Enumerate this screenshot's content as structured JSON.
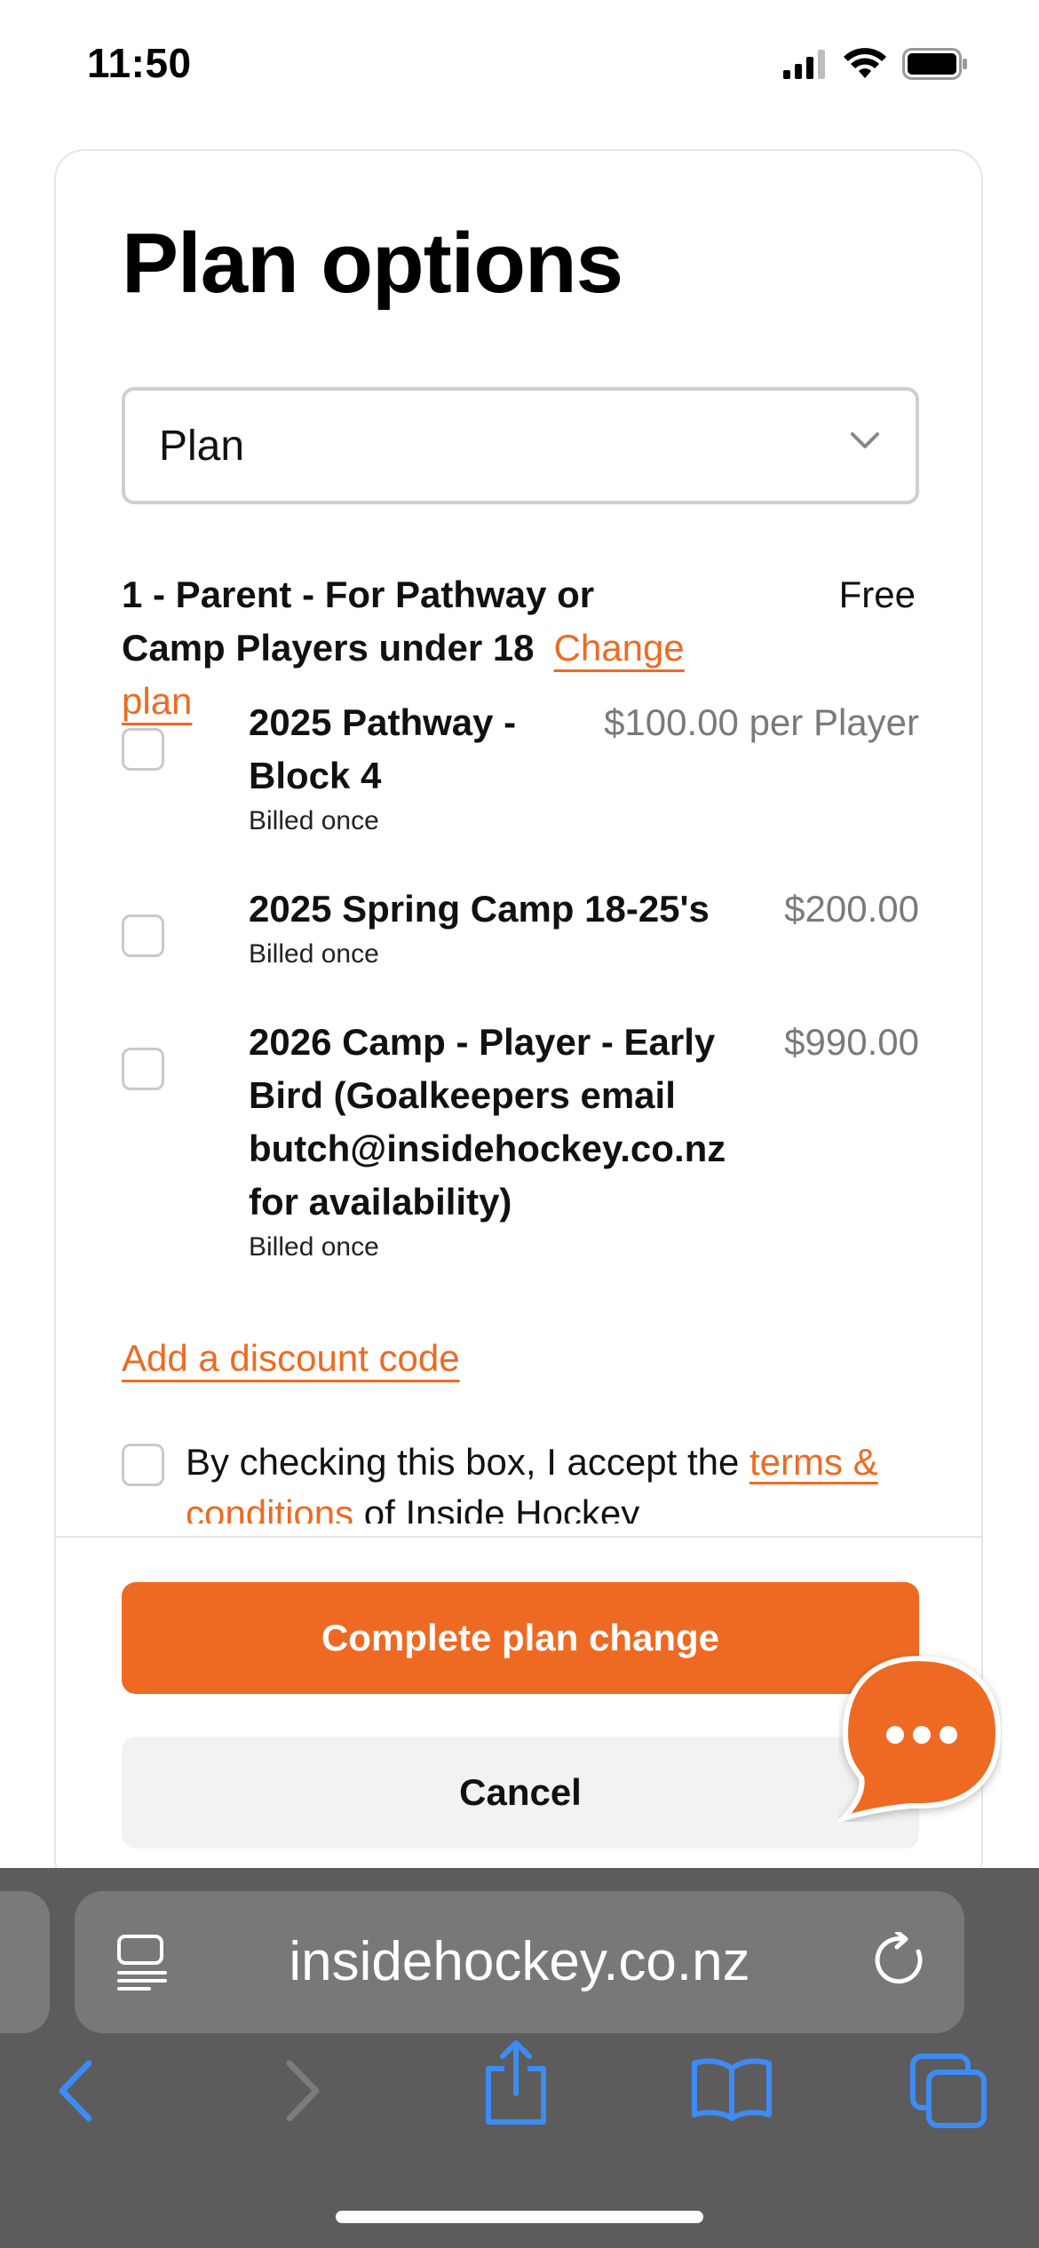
{
  "status_bar": {
    "time": "11:50"
  },
  "page": {
    "title": "Plan options",
    "plan_select": {
      "value": "Plan"
    },
    "current_plan": {
      "name": "1 - Parent - For Pathway or Camp Players under 18",
      "change_link": "Change plan",
      "price": "Free"
    },
    "options": [
      {
        "name": "2025 Pathway - Block 4",
        "price": "$100.00 per Player",
        "billing": "Billed once",
        "checked": false
      },
      {
        "name": "2025 Spring Camp 18-25's",
        "price": "$200.00",
        "billing": "Billed once",
        "checked": false
      },
      {
        "name": "2026 Camp - Player - Early Bird (Goalkeepers email butch@insidehockey.co.nz for availability)",
        "price": "$990.00",
        "billing": "Billed once",
        "checked": false
      }
    ],
    "discount_link": "Add a discount code",
    "terms": {
      "prefix": "By checking this box, I accept the ",
      "link": "terms & conditions",
      "suffix": " of Inside Hockey"
    },
    "complete_button": "Complete plan change",
    "cancel_button": "Cancel"
  },
  "browser": {
    "url": "insidehockey.co.nz",
    "icons": [
      "reader-mode-icon",
      "reload-icon",
      "back-icon",
      "forward-icon",
      "share-icon",
      "bookmarks-icon",
      "tabs-icon",
      "chat-icon"
    ]
  },
  "colors": {
    "accent": "#ee6a23",
    "safari_bar": "#5c5c5c",
    "safari_icon_blue": "#3d8bf5"
  }
}
